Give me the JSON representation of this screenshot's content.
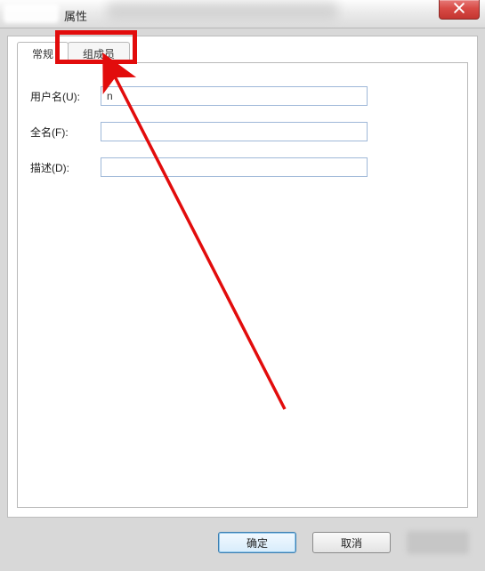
{
  "window": {
    "title_suffix": "属性"
  },
  "tabs": {
    "general": "常规",
    "members": "组成员"
  },
  "form": {
    "username_label": "用户名(U):",
    "username_value": "n",
    "fullname_label": "全名(F):",
    "fullname_value": "",
    "description_label": "描述(D):",
    "description_value": ""
  },
  "buttons": {
    "ok": "确定",
    "cancel": "取消"
  },
  "annotation": {
    "highlight_target": "tab-members",
    "arrow_color": "#e20c0c"
  }
}
